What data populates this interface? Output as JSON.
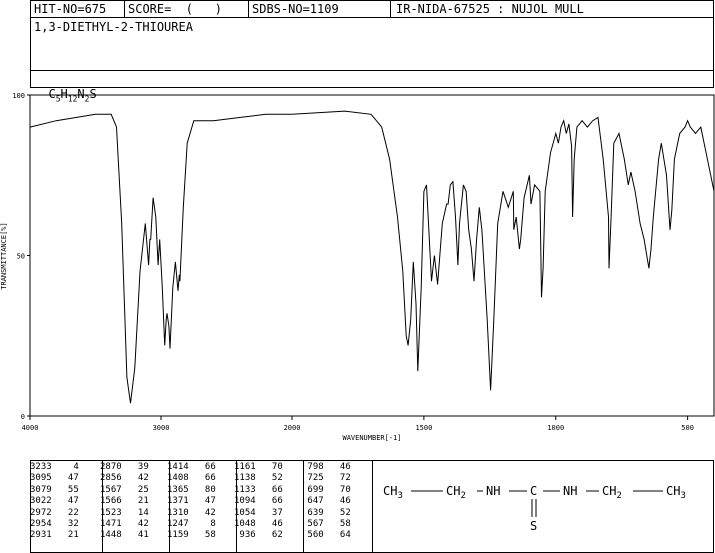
{
  "header": {
    "hit_no": "HIT-NO=675",
    "score": "SCORE=  (   )",
    "sdbs_no": "SDBS-NO=1109",
    "ir_nida": "IR-NIDA-67525 : NUJOL MULL"
  },
  "compound_name": "1,3-DIETHYL-2-THIOUREA",
  "formula": {
    "c": "C",
    "c_n": "5",
    "h": "H",
    "h_n": "12",
    "n": "N",
    "n_n": "2",
    "s": "S"
  },
  "structure": {
    "chain": [
      "CH3",
      "CH2",
      "NH",
      "C",
      "NH",
      "CH2",
      "CH3"
    ],
    "substituent": "S"
  },
  "chart_data": {
    "type": "line",
    "xlabel": "WAVENUMBER[-1]",
    "ylabel": "TRANSMITTANCE[%]",
    "xlim": [
      4000,
      400
    ],
    "ylim": [
      0,
      100
    ],
    "x_ticks": [
      "4000",
      "3000",
      "2000",
      "1500",
      "1000",
      "500"
    ],
    "y_ticks": [
      "100",
      "50",
      "0"
    ],
    "series": [
      {
        "points": [
          [
            4000,
            90
          ],
          [
            3800,
            92
          ],
          [
            3500,
            94
          ],
          [
            3380,
            94
          ],
          [
            3340,
            90
          ],
          [
            3300,
            60
          ],
          [
            3260,
            12
          ],
          [
            3233,
            4
          ],
          [
            3200,
            15
          ],
          [
            3160,
            45
          ],
          [
            3120,
            60
          ],
          [
            3095,
            47
          ],
          [
            3085,
            55
          ],
          [
            3079,
            55
          ],
          [
            3060,
            68
          ],
          [
            3040,
            62
          ],
          [
            3022,
            47
          ],
          [
            3010,
            55
          ],
          [
            2990,
            40
          ],
          [
            2972,
            22
          ],
          [
            2960,
            30
          ],
          [
            2954,
            32
          ],
          [
            2940,
            28
          ],
          [
            2931,
            21
          ],
          [
            2910,
            40
          ],
          [
            2890,
            48
          ],
          [
            2870,
            39
          ],
          [
            2860,
            44
          ],
          [
            2856,
            42
          ],
          [
            2830,
            65
          ],
          [
            2800,
            85
          ],
          [
            2750,
            92
          ],
          [
            2600,
            92
          ],
          [
            2400,
            93
          ],
          [
            2200,
            94
          ],
          [
            2000,
            94
          ],
          [
            1800,
            95
          ],
          [
            1700,
            94
          ],
          [
            1660,
            90
          ],
          [
            1630,
            80
          ],
          [
            1600,
            62
          ],
          [
            1580,
            45
          ],
          [
            1567,
            25
          ],
          [
            1560,
            22
          ],
          [
            1550,
            30
          ],
          [
            1540,
            48
          ],
          [
            1530,
            35
          ],
          [
            1523,
            14
          ],
          [
            1510,
            40
          ],
          [
            1500,
            70
          ],
          [
            1490,
            72
          ],
          [
            1471,
            42
          ],
          [
            1460,
            50
          ],
          [
            1448,
            41
          ],
          [
            1430,
            60
          ],
          [
            1414,
            66
          ],
          [
            1408,
            66
          ],
          [
            1400,
            72
          ],
          [
            1390,
            73
          ],
          [
            1380,
            62
          ],
          [
            1371,
            47
          ],
          [
            1365,
            60
          ],
          [
            1350,
            72
          ],
          [
            1340,
            70
          ],
          [
            1330,
            58
          ],
          [
            1320,
            52
          ],
          [
            1310,
            42
          ],
          [
            1300,
            55
          ],
          [
            1290,
            65
          ],
          [
            1280,
            58
          ],
          [
            1260,
            30
          ],
          [
            1247,
            8
          ],
          [
            1235,
            30
          ],
          [
            1220,
            60
          ],
          [
            1200,
            70
          ],
          [
            1180,
            65
          ],
          [
            1161,
            70
          ],
          [
            1159,
            58
          ],
          [
            1150,
            62
          ],
          [
            1138,
            52
          ],
          [
            1133,
            55
          ],
          [
            1120,
            68
          ],
          [
            1100,
            75
          ],
          [
            1094,
            66
          ],
          [
            1080,
            72
          ],
          [
            1060,
            70
          ],
          [
            1054,
            37
          ],
          [
            1048,
            46
          ],
          [
            1040,
            70
          ],
          [
            1020,
            82
          ],
          [
            1000,
            88
          ],
          [
            990,
            85
          ],
          [
            980,
            90
          ],
          [
            970,
            92
          ],
          [
            960,
            88
          ],
          [
            950,
            91
          ],
          [
            940,
            84
          ],
          [
            936,
            62
          ],
          [
            930,
            80
          ],
          [
            920,
            90
          ],
          [
            910,
            91
          ],
          [
            900,
            92
          ],
          [
            880,
            90
          ],
          [
            860,
            92
          ],
          [
            840,
            93
          ],
          [
            820,
            80
          ],
          [
            800,
            62
          ],
          [
            798,
            46
          ],
          [
            790,
            62
          ],
          [
            780,
            85
          ],
          [
            760,
            88
          ],
          [
            740,
            80
          ],
          [
            725,
            72
          ],
          [
            715,
            76
          ],
          [
            699,
            70
          ],
          [
            680,
            60
          ],
          [
            665,
            55
          ],
          [
            647,
            46
          ],
          [
            639,
            52
          ],
          [
            630,
            62
          ],
          [
            610,
            80
          ],
          [
            600,
            85
          ],
          [
            580,
            75
          ],
          [
            567,
            58
          ],
          [
            560,
            64
          ],
          [
            550,
            80
          ],
          [
            530,
            88
          ],
          [
            510,
            90
          ],
          [
            500,
            92
          ],
          [
            490,
            90
          ],
          [
            470,
            88
          ],
          [
            450,
            90
          ],
          [
            430,
            82
          ],
          [
            400,
            70
          ]
        ]
      }
    ],
    "peaks": [
      [
        3233,
        4
      ],
      [
        3095,
        47
      ],
      [
        3079,
        55
      ],
      [
        3022,
        47
      ],
      [
        2972,
        22
      ],
      [
        2954,
        32
      ],
      [
        2931,
        21
      ],
      [
        2870,
        39
      ],
      [
        2856,
        42
      ],
      [
        1567,
        25
      ],
      [
        1566,
        21
      ],
      [
        1523,
        14
      ],
      [
        1471,
        42
      ],
      [
        1448,
        41
      ],
      [
        1414,
        66
      ],
      [
        1408,
        66
      ],
      [
        1365,
        80
      ],
      [
        1371,
        47
      ],
      [
        1310,
        42
      ],
      [
        1247,
        8
      ],
      [
        1159,
        58
      ],
      [
        1161,
        70
      ],
      [
        1138,
        52
      ],
      [
        1133,
        66
      ],
      [
        1094,
        66
      ],
      [
        1054,
        37
      ],
      [
        1048,
        46
      ],
      [
        936,
        62
      ],
      [
        798,
        46
      ],
      [
        725,
        72
      ],
      [
        699,
        70
      ],
      [
        647,
        46
      ],
      [
        639,
        52
      ],
      [
        567,
        58
      ],
      [
        560,
        64
      ]
    ]
  }
}
